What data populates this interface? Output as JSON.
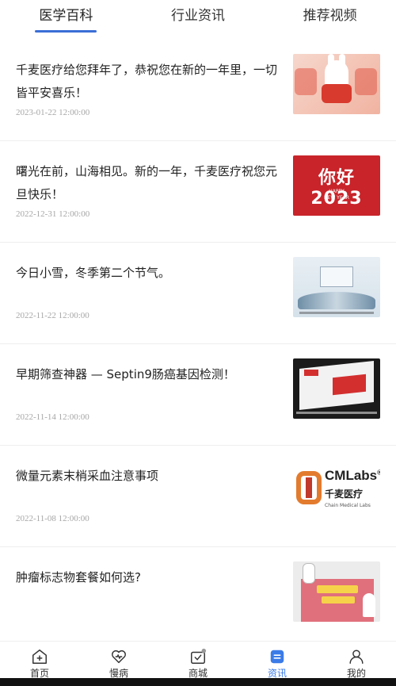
{
  "tabs": [
    {
      "label": "医学百科",
      "active": true
    },
    {
      "label": "行业资讯",
      "active": false
    },
    {
      "label": "推荐视频",
      "active": false
    }
  ],
  "articles": [
    {
      "title": "千麦医疗给您拜年了，恭祝您在新的一年里，一切皆平安喜乐！",
      "date": "2023-01-22 12:00:00"
    },
    {
      "title": "曙光在前，山海相见。新的一年，千麦医疗祝您元旦快乐！",
      "date": "2022-12-31 12:00:00"
    },
    {
      "title": "今日小雪，冬季第二个节气。",
      "date": "2022-11-22 12:00:00"
    },
    {
      "title": "早期筛查神器 — Septin9肠癌基因检测！",
      "date": "2022-11-14 12:00:00"
    },
    {
      "title": "微量元素末梢采血注意事项",
      "date": "2022-11-08 12:00:00"
    },
    {
      "title": "肿瘤标志物套餐如何选?",
      "date": ""
    }
  ],
  "thumbs": {
    "t2_big": "你好2023",
    "t2_line1": "HAPPY",
    "t2_line2": "NEW YEAR",
    "t5_brand": "CMLabs",
    "t5_reg": "®",
    "t5_cn": "千麦医疗",
    "t5_en": "Chain Medical Labs"
  },
  "nav": [
    {
      "label": "首页",
      "icon": "home-icon",
      "active": false
    },
    {
      "label": "慢病",
      "icon": "heart-icon",
      "active": false
    },
    {
      "label": "商城",
      "icon": "cart-icon",
      "active": false
    },
    {
      "label": "资讯",
      "icon": "news-icon",
      "active": true
    },
    {
      "label": "我的",
      "icon": "user-icon",
      "active": false
    }
  ],
  "colors": {
    "accent": "#3b6fd6",
    "nav_active": "#3b7be8"
  }
}
